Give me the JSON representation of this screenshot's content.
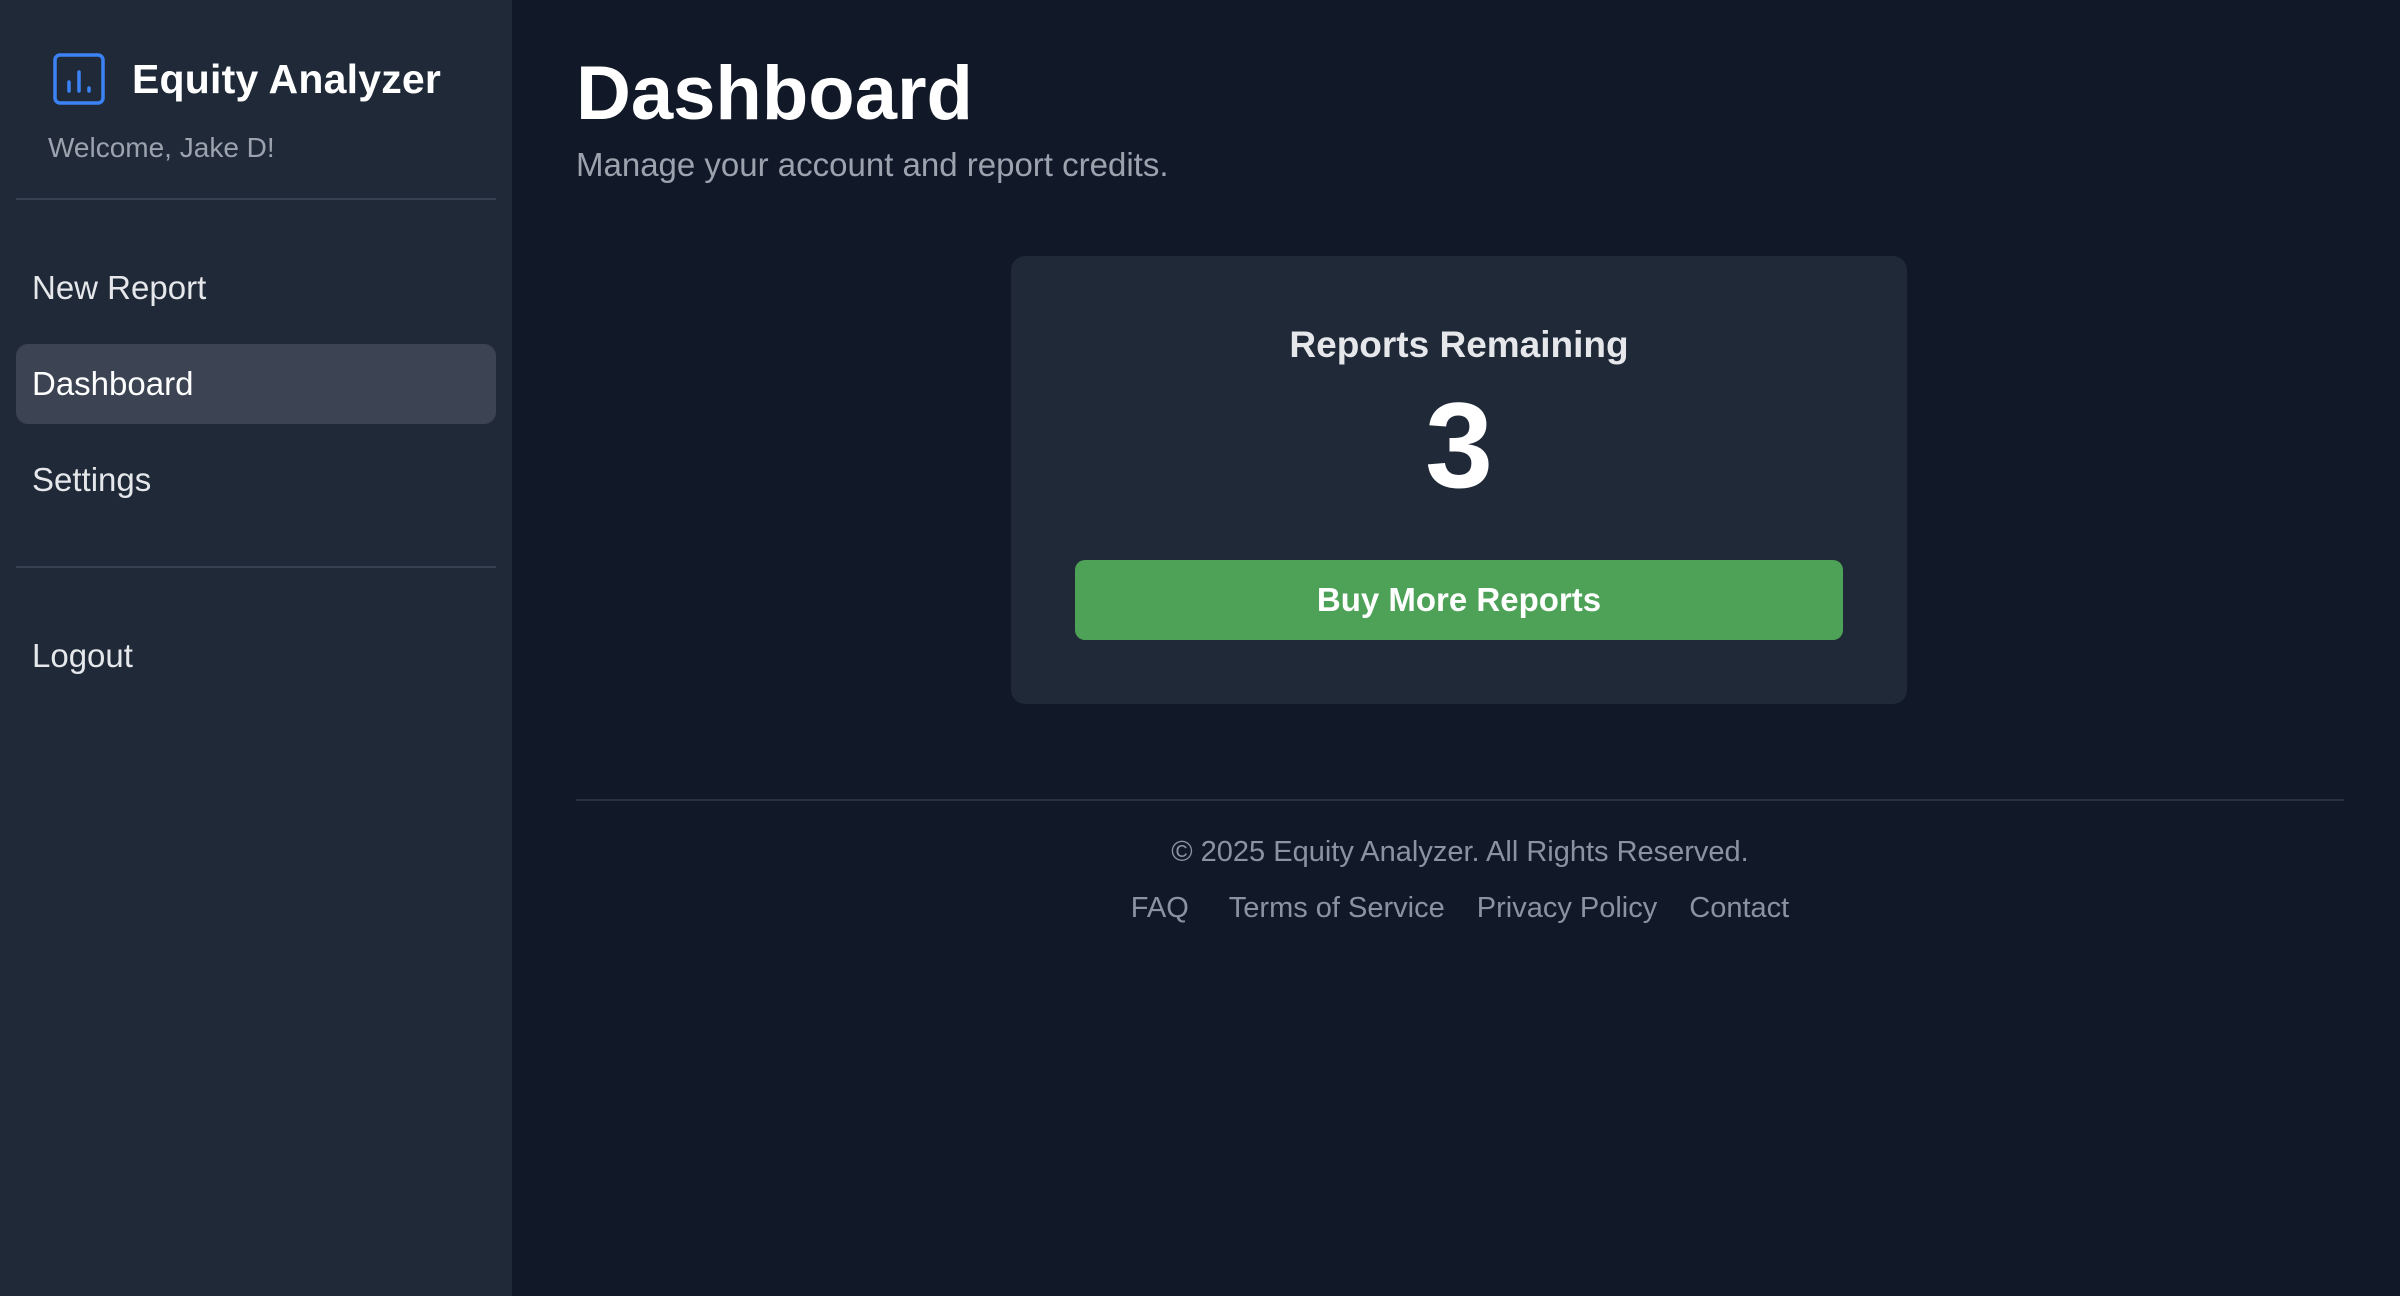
{
  "sidebar": {
    "app_title": "Equity Analyzer",
    "logo_icon": "bar-chart-icon",
    "welcome": "Welcome, Jake D!",
    "nav_items": [
      {
        "label": "New Report",
        "active": false
      },
      {
        "label": "Dashboard",
        "active": true
      },
      {
        "label": "Settings",
        "active": false
      }
    ],
    "logout_label": "Logout"
  },
  "main": {
    "title": "Dashboard",
    "subtitle": "Manage your account and report credits.",
    "card": {
      "label": "Reports Remaining",
      "count": "3",
      "button_label": "Buy More Reports"
    }
  },
  "footer": {
    "copyright": "© 2025 Equity Analyzer. All Rights Reserved.",
    "links": [
      "FAQ",
      "Terms of Service",
      "Privacy Policy",
      "Contact"
    ]
  },
  "colors": {
    "background": "#111827",
    "sidebar": "#1f2937",
    "accent_blue": "#3b82f6",
    "button_green": "#4da257",
    "nav_active": "#3c4454"
  }
}
